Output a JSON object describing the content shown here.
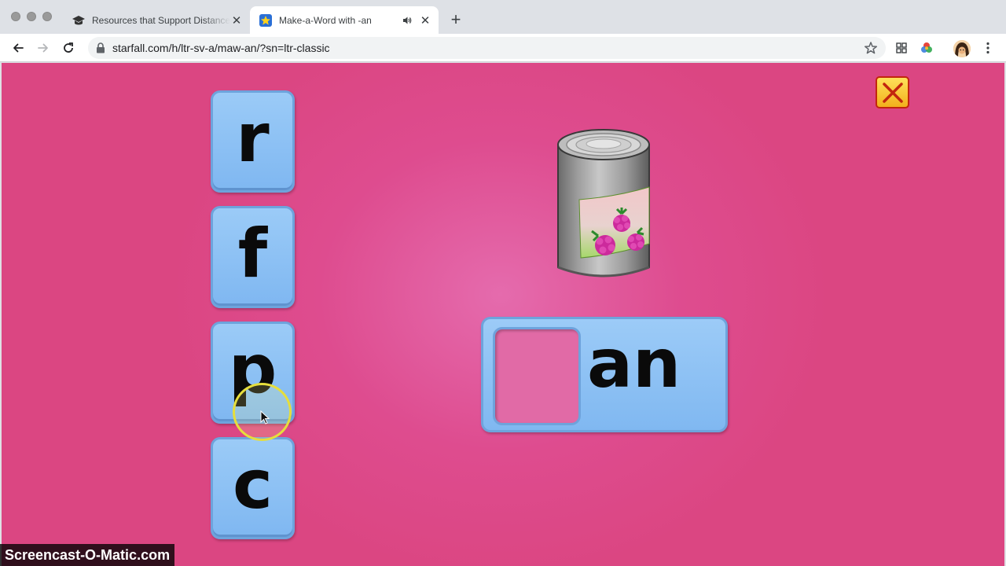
{
  "browser": {
    "tabs": [
      {
        "title": "Resources that Support Distance Learning",
        "favicon": "graduation-cap-icon",
        "active": false
      },
      {
        "title": "Make-a-Word with -an",
        "favicon": "starfall-star-icon",
        "active": true,
        "audio_playing": true
      }
    ],
    "address_bar": {
      "url": "starfall.com/h/ltr-sv-a/maw-an/?sn=ltr-classic"
    }
  },
  "game": {
    "letters": [
      "r",
      "f",
      "p",
      "c"
    ],
    "word_ending": "an",
    "picture": "can-of-berries",
    "colors": {
      "background": "#db4682",
      "tile": "#8ec2f5",
      "slot": "#e16aa6",
      "close": "#f7c431"
    }
  },
  "watermark": "Screencast-O-Matic.com"
}
